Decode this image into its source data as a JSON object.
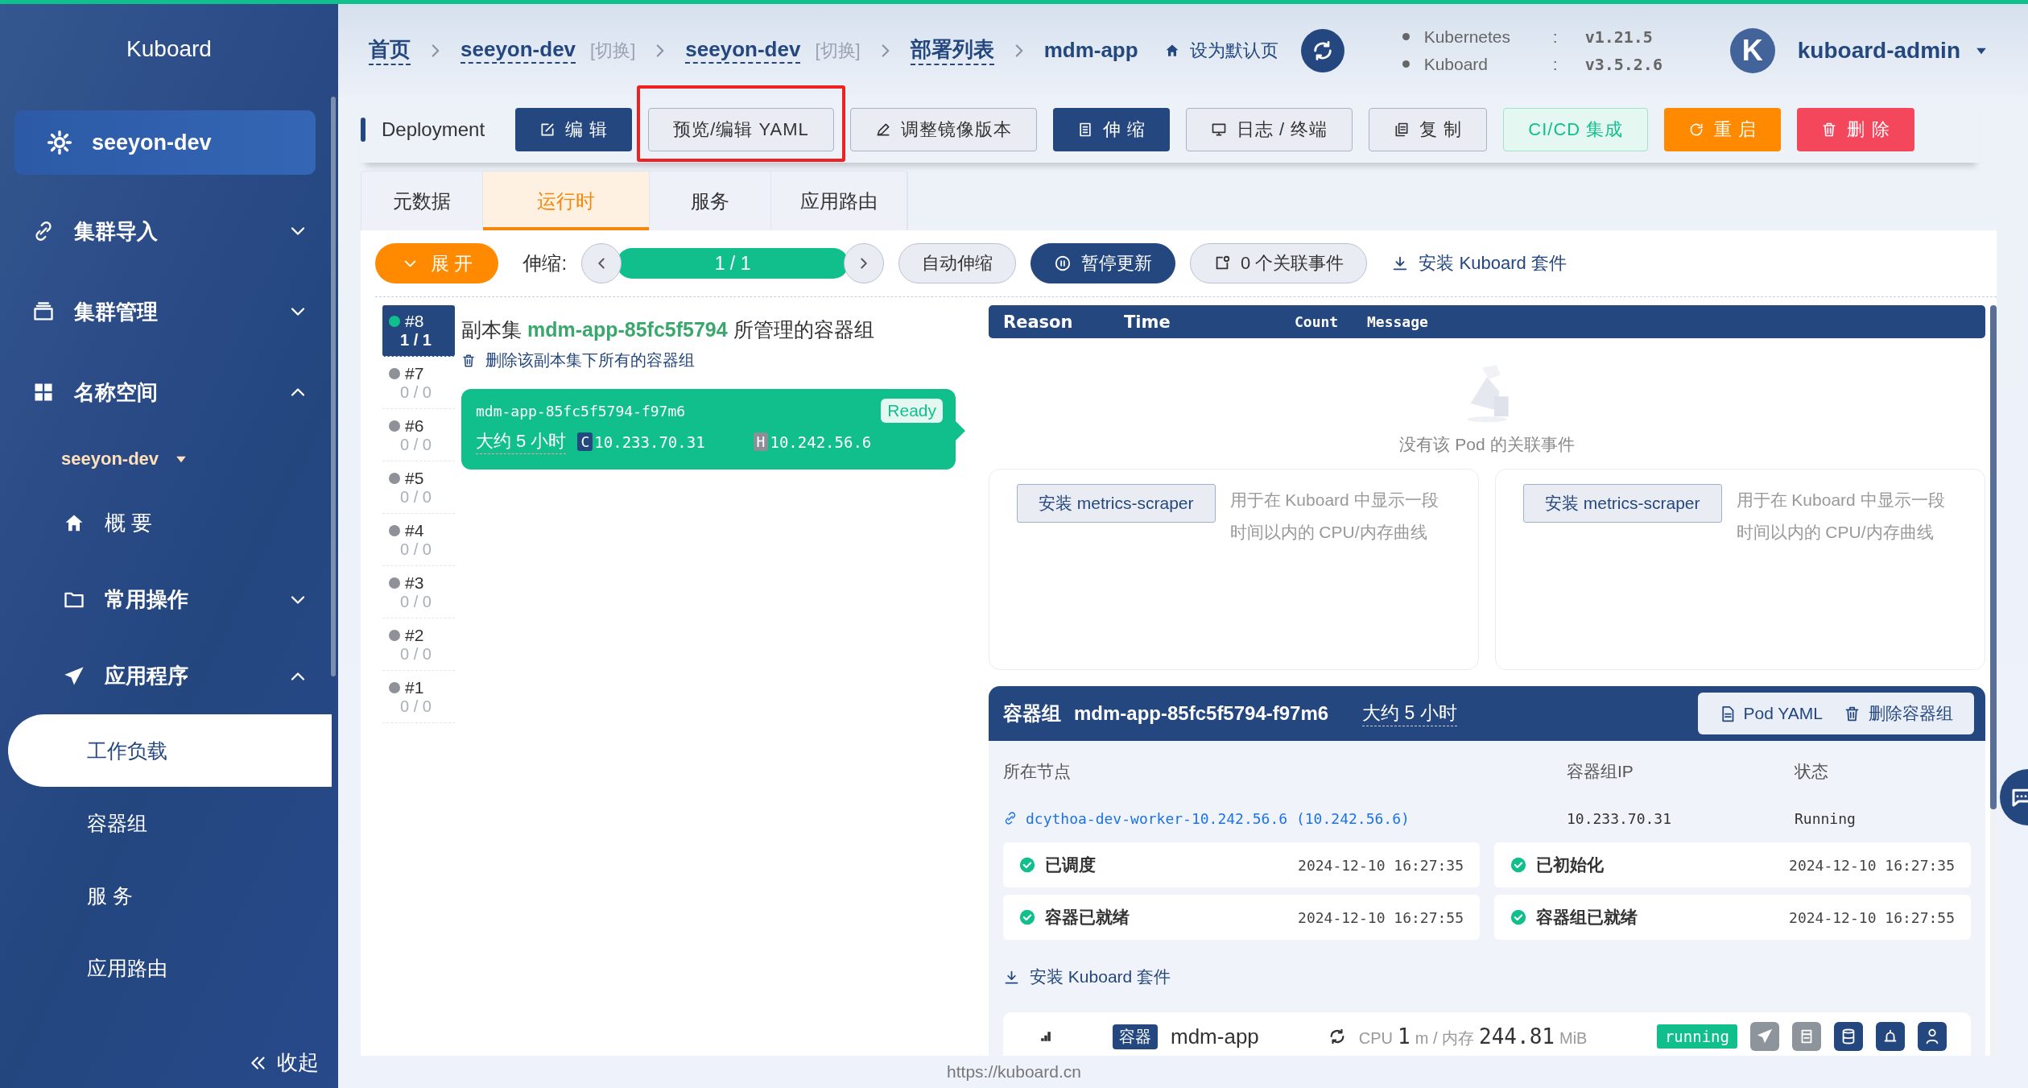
{
  "sidebar": {
    "brand": "Kuboard",
    "cluster": "seeyon-dev",
    "items": [
      {
        "label": "集群导入",
        "expanded": false
      },
      {
        "label": "集群管理",
        "expanded": false
      },
      {
        "label": "名称空间",
        "expanded": true,
        "namespace": "seeyon-dev",
        "children": [
          {
            "label": "概 要"
          },
          {
            "label": "常用操作",
            "expanded": false
          },
          {
            "label": "应用程序",
            "expanded": true,
            "children": [
              {
                "label": "工作负载",
                "selected": true
              },
              {
                "label": "容器组",
                "selected": false
              },
              {
                "label": "服 务",
                "selected": false
              },
              {
                "label": "应用路由",
                "selected": false
              }
            ]
          }
        ]
      }
    ],
    "collapse": "收起"
  },
  "breadcrumb": [
    {
      "label": "首页",
      "kind": "link"
    },
    {
      "label": "seeyon-dev",
      "kind": "link",
      "switch": "[切换]"
    },
    {
      "label": "seeyon-dev",
      "kind": "link",
      "switch": "[切换]"
    },
    {
      "label": "部署列表",
      "kind": "link"
    },
    {
      "label": "mdm-app",
      "kind": "current"
    }
  ],
  "set_default": "设为默认页",
  "versions": {
    "separator": ":",
    "items": [
      {
        "name": "Kubernetes",
        "value": "v1.21.5"
      },
      {
        "name": "Kuboard",
        "value": "v3.5.2.6"
      }
    ]
  },
  "user": {
    "initial": "K",
    "name": "kuboard-admin"
  },
  "toolbar": {
    "kind": "Deployment",
    "buttons": [
      {
        "label": "编 辑",
        "highlighted": false
      },
      {
        "label": "预览/编辑 YAML",
        "highlighted": true
      },
      {
        "label": "调整镜像版本",
        "highlighted": false
      },
      {
        "label": "伸 缩",
        "highlighted": false
      },
      {
        "label": "日志 / 终端",
        "highlighted": false
      },
      {
        "label": "复 制",
        "highlighted": false
      },
      {
        "label": "CI/CD 集成",
        "highlighted": false
      },
      {
        "label": "重 启",
        "highlighted": false
      },
      {
        "label": "删 除",
        "highlighted": false
      }
    ]
  },
  "tabs": [
    {
      "label": "元数据",
      "selected": false
    },
    {
      "label": "运行时",
      "selected": true
    },
    {
      "label": "服务",
      "selected": false
    },
    {
      "label": "应用路由",
      "selected": false
    }
  ],
  "controls": {
    "expand": "展 开",
    "scale_label": "伸缩:",
    "replicas": "1 / 1",
    "auto_scale": "自动伸缩",
    "pause": "暂停更新",
    "events": "0 个关联事件",
    "install": "安装 Kuboard 套件"
  },
  "revisions": [
    {
      "label": "#8",
      "count": "1 / 1",
      "selected": true,
      "active": true
    },
    {
      "label": "#7",
      "count": "0 / 0",
      "selected": false,
      "active": false
    },
    {
      "label": "#6",
      "count": "0 / 0",
      "selected": false,
      "active": false
    },
    {
      "label": "#5",
      "count": "0 / 0",
      "selected": false,
      "active": false
    },
    {
      "label": "#4",
      "count": "0 / 0",
      "selected": false,
      "active": false
    },
    {
      "label": "#3",
      "count": "0 / 0",
      "selected": false,
      "active": false
    },
    {
      "label": "#2",
      "count": "0 / 0",
      "selected": false,
      "active": false
    },
    {
      "label": "#1",
      "count": "0 / 0",
      "selected": false,
      "active": false
    }
  ],
  "replica_set": {
    "prefix": "副本集",
    "name": "mdm-app-85fc5f5794",
    "suffix": "所管理的容器组",
    "delete": "删除该副本集下所有的容器组",
    "pod": {
      "name": "mdm-app-85fc5f5794-f97m6",
      "status": "Ready",
      "age": "大约 5 小时",
      "container_badge": "C",
      "container_ip": "10.233.70.31",
      "host_badge": "H",
      "host_ip": "10.242.56.6"
    }
  },
  "events": {
    "columns": [
      "Reason",
      "Time",
      "Count",
      "Message"
    ],
    "empty": "没有该 Pod 的关联事件"
  },
  "metrics": [
    {
      "button": "安装 metrics-scraper",
      "text": "用于在 Kuboard 中显示一段时间以内的 CPU/内存曲线"
    },
    {
      "button": "安装 metrics-scraper",
      "text": "用于在 Kuboard 中显示一段时间以内的 CPU/内存曲线"
    }
  ],
  "pod_panel": {
    "label": "容器组",
    "name": "mdm-app-85fc5f5794-f97m6",
    "age": "大约 5 小时",
    "actions": [
      "Pod YAML",
      "删除容器组"
    ],
    "fields": [
      {
        "label": "所在节点",
        "value": "dcythoa-dev-worker-10.242.56.6 (10.242.56.6)",
        "kind": "link"
      },
      {
        "label": "容器组IP",
        "value": "10.233.70.31",
        "kind": "text"
      },
      {
        "label": "状态",
        "value": "Running",
        "kind": "text"
      }
    ],
    "conditions": [
      {
        "label": "已调度",
        "time": "2024-12-10 16:27:35",
        "ok": true
      },
      {
        "label": "已初始化",
        "time": "2024-12-10 16:27:35",
        "ok": true
      },
      {
        "label": "容器已就绪",
        "time": "2024-12-10 16:27:55",
        "ok": true
      },
      {
        "label": "容器组已就绪",
        "time": "2024-12-10 16:27:55",
        "ok": true
      }
    ],
    "install": "安装 Kuboard 套件",
    "container": {
      "tag": "容器",
      "name": "mdm-app",
      "usage": [
        {
          "text": "CPU",
          "kind": "unit"
        },
        {
          "text": "1",
          "kind": "value"
        },
        {
          "text": "m / 内存",
          "kind": "unit"
        },
        {
          "text": "244.81",
          "kind": "value"
        },
        {
          "text": "MiB",
          "kind": "unit"
        }
      ],
      "status": "running"
    }
  },
  "footer": "https://kuboard.cn"
}
